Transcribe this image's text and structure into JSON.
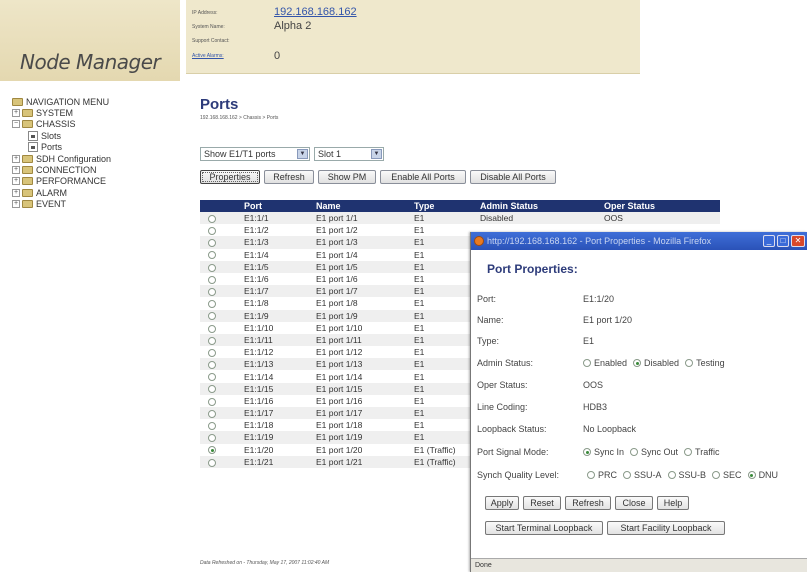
{
  "header": {
    "app_title": "Node Manager",
    "info": [
      {
        "label": "IP Address:",
        "value": "192.168.168.162",
        "link": true
      },
      {
        "label": "System Name:",
        "value": "Alpha 2",
        "link": false
      },
      {
        "label": "Support Contact:",
        "value": "",
        "link": false
      },
      {
        "label": "Active Alarms:",
        "value": "0",
        "link": false
      }
    ]
  },
  "sidebar": {
    "items": [
      {
        "label": "NAVIGATION MENU",
        "type": "root"
      },
      {
        "label": "SYSTEM",
        "type": "folder"
      },
      {
        "label": "CHASSIS",
        "type": "folder"
      },
      {
        "label": "Slots",
        "type": "doc"
      },
      {
        "label": "Ports",
        "type": "doc"
      },
      {
        "label": "SDH Configuration",
        "type": "folder"
      },
      {
        "label": "CONNECTION",
        "type": "folder"
      },
      {
        "label": "PERFORMANCE",
        "type": "folder"
      },
      {
        "label": "ALARM",
        "type": "folder"
      },
      {
        "label": "EVENT",
        "type": "folder"
      }
    ]
  },
  "main": {
    "title": "Ports",
    "breadcrumb": "192.168.168.162 > Chassis > Ports",
    "port_filter": "Show E1/T1 ports",
    "slot_filter": "Slot 1",
    "buttons": {
      "properties": "Properties",
      "refresh": "Refresh",
      "show_pm": "Show PM",
      "enable_all": "Enable All Ports",
      "disable_all": "Disable All Ports"
    },
    "columns": [
      "Port",
      "Name",
      "Type",
      "Admin Status",
      "Oper Status"
    ],
    "rows": [
      {
        "port": "E1:1/1",
        "name": "E1 port 1/1",
        "type": "E1",
        "admin": "Disabled",
        "oper": "OOS",
        "selected": false
      },
      {
        "port": "E1:1/2",
        "name": "E1 port 1/2",
        "type": "E1",
        "admin": "",
        "oper": "",
        "selected": false
      },
      {
        "port": "E1:1/3",
        "name": "E1 port 1/3",
        "type": "E1",
        "admin": "",
        "oper": "",
        "selected": false
      },
      {
        "port": "E1:1/4",
        "name": "E1 port 1/4",
        "type": "E1",
        "admin": "",
        "oper": "",
        "selected": false
      },
      {
        "port": "E1:1/5",
        "name": "E1 port 1/5",
        "type": "E1",
        "admin": "",
        "oper": "",
        "selected": false
      },
      {
        "port": "E1:1/6",
        "name": "E1 port 1/6",
        "type": "E1",
        "admin": "",
        "oper": "",
        "selected": false
      },
      {
        "port": "E1:1/7",
        "name": "E1 port 1/7",
        "type": "E1",
        "admin": "",
        "oper": "",
        "selected": false
      },
      {
        "port": "E1:1/8",
        "name": "E1 port 1/8",
        "type": "E1",
        "admin": "",
        "oper": "",
        "selected": false
      },
      {
        "port": "E1:1/9",
        "name": "E1 port 1/9",
        "type": "E1",
        "admin": "",
        "oper": "",
        "selected": false
      },
      {
        "port": "E1:1/10",
        "name": "E1 port 1/10",
        "type": "E1",
        "admin": "",
        "oper": "",
        "selected": false
      },
      {
        "port": "E1:1/11",
        "name": "E1 port 1/11",
        "type": "E1",
        "admin": "",
        "oper": "",
        "selected": false
      },
      {
        "port": "E1:1/12",
        "name": "E1 port 1/12",
        "type": "E1",
        "admin": "",
        "oper": "",
        "selected": false
      },
      {
        "port": "E1:1/13",
        "name": "E1 port 1/13",
        "type": "E1",
        "admin": "",
        "oper": "",
        "selected": false
      },
      {
        "port": "E1:1/14",
        "name": "E1 port 1/14",
        "type": "E1",
        "admin": "",
        "oper": "",
        "selected": false
      },
      {
        "port": "E1:1/15",
        "name": "E1 port 1/15",
        "type": "E1",
        "admin": "",
        "oper": "",
        "selected": false
      },
      {
        "port": "E1:1/16",
        "name": "E1 port 1/16",
        "type": "E1",
        "admin": "",
        "oper": "",
        "selected": false
      },
      {
        "port": "E1:1/17",
        "name": "E1 port 1/17",
        "type": "E1",
        "admin": "",
        "oper": "",
        "selected": false
      },
      {
        "port": "E1:1/18",
        "name": "E1 port 1/18",
        "type": "E1",
        "admin": "",
        "oper": "",
        "selected": false
      },
      {
        "port": "E1:1/19",
        "name": "E1 port 1/19",
        "type": "E1",
        "admin": "",
        "oper": "",
        "selected": false
      },
      {
        "port": "E1:1/20",
        "name": "E1 port 1/20",
        "type": "E1 (Traffic)",
        "admin": "",
        "oper": "",
        "selected": true
      },
      {
        "port": "E1:1/21",
        "name": "E1 port 1/21",
        "type": "E1 (Traffic)",
        "admin": "",
        "oper": "",
        "selected": false
      }
    ],
    "footer": "Data Refreshed on - Thursday, May 17, 2007 11:02:40 AM"
  },
  "popup": {
    "window_title": "http://192.168.168.162 - Port Properties - Mozilla Firefox",
    "heading": "Port Properties:",
    "fields": {
      "port_label": "Port:",
      "port_value": "E1:1/20",
      "name_label": "Name:",
      "name_value": "E1 port 1/20",
      "type_label": "Type:",
      "type_value": "E1",
      "admin_label": "Admin Status:",
      "admin_options": [
        "Enabled",
        "Disabled",
        "Testing"
      ],
      "admin_selected": "Disabled",
      "oper_label": "Oper Status:",
      "oper_value": "OOS",
      "coding_label": "Line Coding:",
      "coding_value": "HDB3",
      "loopback_label": "Loopback Status:",
      "loopback_value": "No Loopback",
      "signal_label": "Port Signal Mode:",
      "signal_options": [
        "Sync In",
        "Sync Out",
        "Traffic"
      ],
      "signal_selected": "Sync In",
      "quality_label": "Synch Quality Level:",
      "quality_options": [
        "PRC",
        "SSU-A",
        "SSU-B",
        "SEC",
        "DNU"
      ],
      "quality_selected": "DNU"
    },
    "buttons": {
      "apply": "Apply",
      "reset": "Reset",
      "refresh": "Refresh",
      "close": "Close",
      "help": "Help",
      "terminal_loopback": "Start Terminal Loopback",
      "facility_loopback": "Start Facility Loopback"
    },
    "status": "Done"
  },
  "colors": {
    "table_header": "#1f3370",
    "title_text": "#2d3b7a",
    "header_bg": "#efe8cc",
    "popup_titlebar": "#2a52b8"
  }
}
